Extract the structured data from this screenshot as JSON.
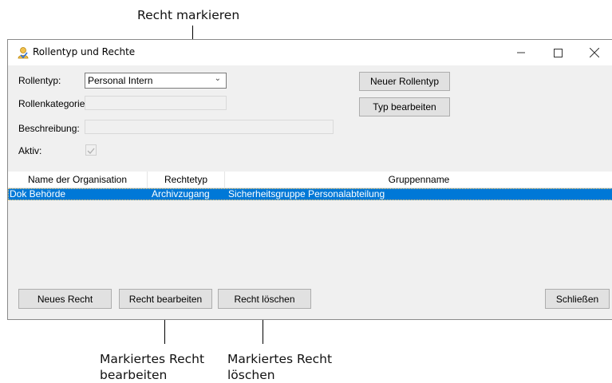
{
  "callouts": {
    "top": "Recht markieren",
    "edit_line1": "Markiertes Recht",
    "edit_line2": "bearbeiten",
    "delete_line1": "Markiertes Recht",
    "delete_line2": "löschen"
  },
  "window": {
    "title": "Rollentyp und Rechte",
    "icon": "role-user-icon"
  },
  "form": {
    "rollentyp_label": "Rollentyp:",
    "rollentyp_value": "Personal Intern",
    "rollenkategorie_label": "Rollenkategorie:",
    "rollenkategorie_value": "",
    "beschreibung_label": "Beschreibung:",
    "beschreibung_value": "",
    "aktiv_label": "Aktiv:",
    "aktiv_checked": true
  },
  "buttons": {
    "new_type": "Neuer Rollentyp",
    "edit_type": "Typ bearbeiten",
    "new_right": "Neues Recht",
    "edit_right": "Recht bearbeiten",
    "delete_right": "Recht löschen",
    "close": "Schließen"
  },
  "grid": {
    "columns": [
      "Name der Organisation",
      "Rechtetyp",
      "Gruppenname"
    ],
    "rows": [
      [
        "Dok Behörde",
        "Archivzugang",
        "Sicherheitsgruppe Personalabteilung"
      ]
    ],
    "selected_row": 0,
    "selection_color": "#0078d7"
  }
}
